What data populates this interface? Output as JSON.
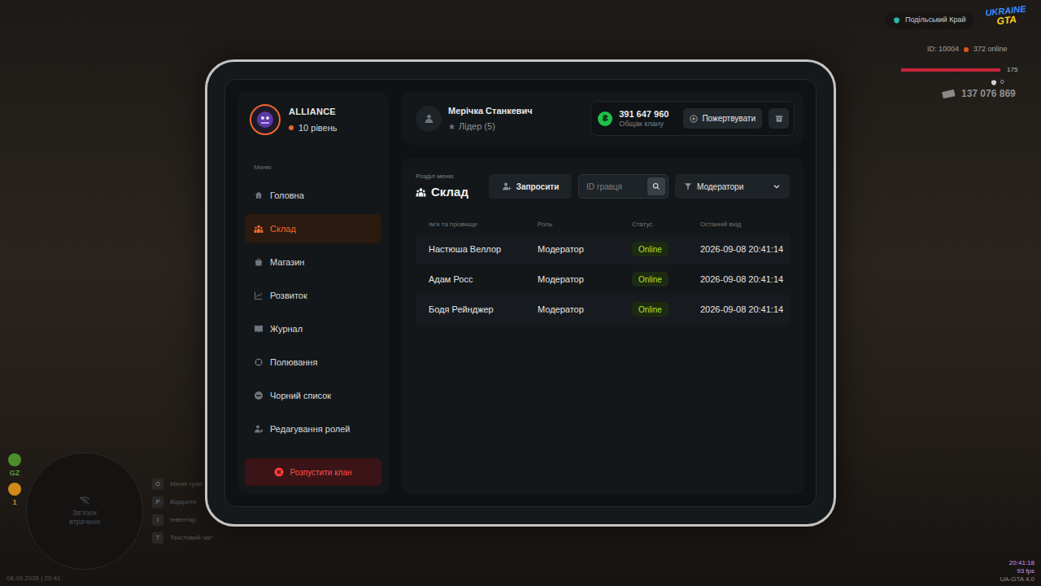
{
  "hud": {
    "server": "Подільський Край",
    "logo": [
      "UKRAINE",
      "GTA"
    ],
    "player_id": "ID: 10004",
    "online": "372 online",
    "health": "175",
    "health_level": 1,
    "armor": "0",
    "money": "137 076 869",
    "radar": "Зв'язок втрачено",
    "gz": "GZ",
    "wanted": "1",
    "datetime": "08.09.2026 | 20:41",
    "clock": "20:41:18",
    "fps": "93 fps",
    "version": "UA-GTA 4.0",
    "hints": [
      {
        "key": "O",
        "label": "Меню грав"
      },
      {
        "key": "P",
        "label": "Відкрити"
      },
      {
        "key": "I",
        "label": "Інвентар"
      },
      {
        "key": "T",
        "label": "Текстовий чат"
      }
    ]
  },
  "clan": {
    "name": "ALLIANCE",
    "level": "10 рівень"
  },
  "sidebar": {
    "heading": "Меню",
    "items": [
      {
        "label": "Головна",
        "selected": false
      },
      {
        "label": "Склад",
        "selected": true
      },
      {
        "label": "Магазин",
        "selected": false
      },
      {
        "label": "Розвиток",
        "selected": false
      },
      {
        "label": "Журнал",
        "selected": false
      },
      {
        "label": "Полювання",
        "selected": false
      },
      {
        "label": "Чорний список",
        "selected": false
      },
      {
        "label": "Редагування ролей",
        "selected": false
      }
    ],
    "disband": "Розпустити клан"
  },
  "user": {
    "name": "Мерічка Станкевич",
    "role": "Лідер (5)"
  },
  "bank": {
    "currency": "₴",
    "amount": "391 647 960",
    "label": "Общак клану",
    "donate": "Пожертвувати"
  },
  "section": {
    "caption": "Розділ меню",
    "title": "Склад"
  },
  "toolbar": {
    "invite": "Запросити",
    "search_placeholder": "ID гравця",
    "filter": "Модератори"
  },
  "table": {
    "columns": [
      "Ім'я та прізвище",
      "Роль",
      "Статус",
      "Останній вхід"
    ],
    "rows": [
      [
        "Настюша Веллор",
        "Модератор",
        "Online",
        "2026-09-08 20:41:14"
      ],
      [
        "Адам Росс",
        "Модератор",
        "Online",
        "2026-09-08 20:41:14"
      ],
      [
        "Бодя Рейнджер",
        "Модератор",
        "Online",
        "2026-09-08 20:41:14"
      ]
    ]
  }
}
